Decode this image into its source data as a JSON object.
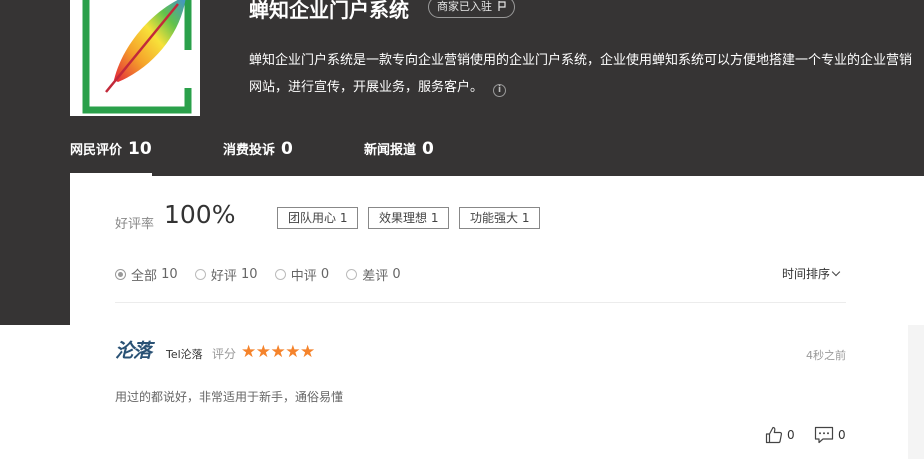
{
  "company": {
    "title": "蝉知企业门户系统",
    "badge": "商家已入驻",
    "badge_icon": "flag-icon",
    "description": "蝉知企业门户系统是一款专向企业营销使用的企业门户系统，企业使用蝉知系统可以方便地搭建一个专业的企业营销网站，进行宣传，开展业务，服务客户。",
    "info_icon": "info-icon"
  },
  "tabs": [
    {
      "label": "网民评价",
      "count": "10"
    },
    {
      "label": "消费投诉",
      "count": "0"
    },
    {
      "label": "新闻报道",
      "count": "0"
    }
  ],
  "rating": {
    "label": "好评率",
    "value": "100%",
    "tags": [
      "团队用心 1",
      "效果理想 1",
      "功能强大 1"
    ]
  },
  "filters": [
    {
      "label": "全部",
      "count": "10",
      "checked": true
    },
    {
      "label": "好评",
      "count": "10",
      "checked": false
    },
    {
      "label": "中评",
      "count": "0",
      "checked": false
    },
    {
      "label": "差评",
      "count": "0",
      "checked": false
    }
  ],
  "sort_label": "时间排序",
  "review": {
    "avatar_text": "沦落",
    "username": "Tel沦落",
    "score_label": "评分",
    "stars": 5,
    "star_color": "#f5832b",
    "time": "4秒之前",
    "text": "用过的都说好，非常适用于新手，通俗易懂",
    "likes": "0",
    "comments": "0"
  },
  "colors": {
    "hero_bg": "#363434",
    "logo_frame": "#2aa04a"
  }
}
